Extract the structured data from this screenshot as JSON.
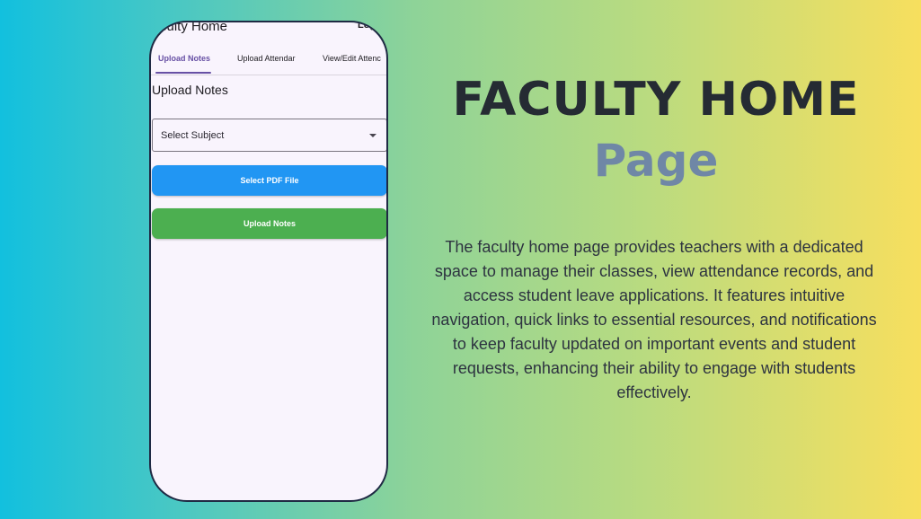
{
  "app": {
    "title": "culty Home",
    "logout_label": "Log"
  },
  "tabs": [
    {
      "label": "Upload Notes",
      "active": true
    },
    {
      "label": "Upload Attendar",
      "active": false
    },
    {
      "label": "View/Edit Attenc",
      "active": false
    }
  ],
  "form": {
    "section_title": "Upload Notes",
    "subject_select": {
      "placeholder": "Select Subject"
    },
    "select_pdf_label": "Select PDF File",
    "upload_label": "Upload Notes"
  },
  "slide": {
    "headline": "FACULTY HOME",
    "subheadline": "Page",
    "description": "The faculty home page provides teachers with a dedicated space to manage their classes, view attendance records, and access student leave applications. It features intuitive navigation, quick links to essential resources, and notifications to keep faculty updated on important events and student requests, enhancing their ability to engage with students effectively."
  },
  "colors": {
    "primary": "#6750a4",
    "pdf_button": "#2196f3",
    "upload_button": "#4caf50",
    "headline": "#252b33",
    "subheadline": "#6f87a6"
  }
}
